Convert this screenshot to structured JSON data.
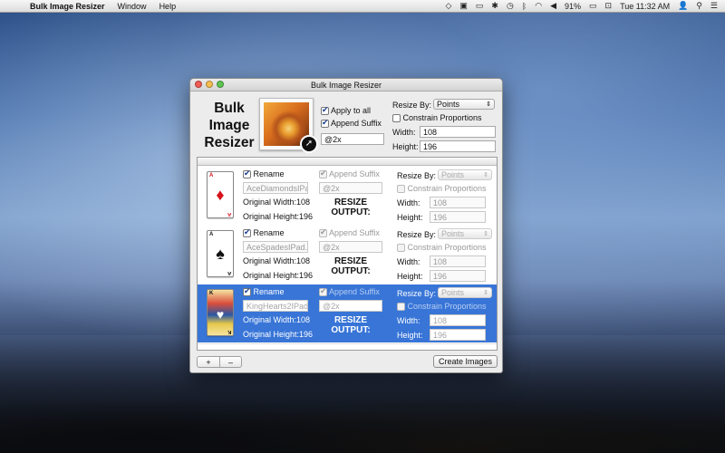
{
  "menubar": {
    "app_name": "Bulk Image Resizer",
    "items": [
      "Window",
      "Help"
    ],
    "battery": "91%",
    "clock": "Tue 11:32 AM"
  },
  "window": {
    "title": "Bulk Image Resizer",
    "logo_lines": [
      "Bulk",
      "Image",
      "Resizer"
    ]
  },
  "global": {
    "apply_to_all_label": "Apply to all",
    "append_suffix_label": "Append Suffix",
    "suffix_value": "@2x",
    "resize_by_label": "Resize By:",
    "resize_by_value": "Points",
    "constrain_label": "Constrain Proportions",
    "width_label": "Width:",
    "width_value": "108",
    "height_label": "Height:",
    "height_value": "196"
  },
  "rows": [
    {
      "rename_label": "Rename",
      "filename": "AceDiamondsIPad",
      "original_width": "Original Width:108",
      "original_height": "Original Height:196",
      "append_suffix_label": "Append Suffix",
      "suffix": "@2x",
      "resize_output": [
        "RESIZE",
        "OUTPUT:"
      ],
      "resize_by_label": "Resize By:",
      "resize_by_value": "Points",
      "constrain_label": "Constrain Proportions",
      "width_label": "Width:",
      "width_value": "108",
      "height_label": "Height:",
      "height_value": "196",
      "card_rank": "A",
      "card_suit": "♦",
      "card_color": "red"
    },
    {
      "rename_label": "Rename",
      "filename": "AceSpadesIPad.p",
      "original_width": "Original Width:108",
      "original_height": "Original Height:196",
      "append_suffix_label": "Append Suffix",
      "suffix": "@2x",
      "resize_output": [
        "RESIZE",
        "OUTPUT:"
      ],
      "resize_by_label": "Resize By:",
      "resize_by_value": "Points",
      "constrain_label": "Constrain Proportions",
      "width_label": "Width:",
      "width_value": "108",
      "height_label": "Height:",
      "height_value": "196",
      "card_rank": "A",
      "card_suit": "♠",
      "card_color": "black"
    },
    {
      "rename_label": "Rename",
      "filename": "KingHearts2IPad.",
      "original_width": "Original Width:108",
      "original_height": "Original Height:196",
      "append_suffix_label": "Append Suffix",
      "suffix": "@2x",
      "resize_output": [
        "RESIZE",
        "OUTPUT:"
      ],
      "resize_by_label": "Resize By:",
      "resize_by_value": "Points",
      "constrain_label": "Constrain Proportions",
      "width_label": "Width:",
      "width_value": "108",
      "height_label": "Height:",
      "height_value": "196",
      "card_rank": "K",
      "card_suit": "♥",
      "card_color": "king"
    }
  ],
  "bottom": {
    "add_label": "+",
    "remove_label": "–",
    "create_label": "Create Images"
  }
}
